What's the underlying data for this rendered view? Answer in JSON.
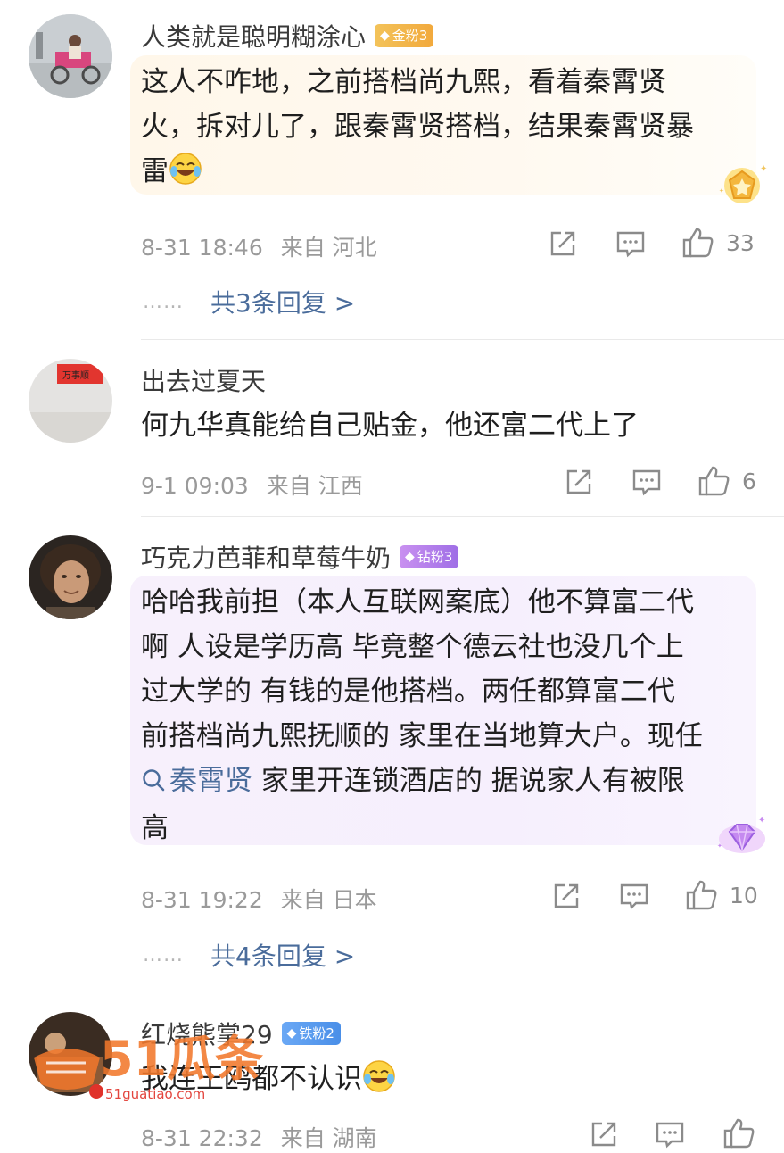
{
  "comments": [
    {
      "username": "人类就是聪明糊涂心",
      "badge": "金粉3",
      "lines": [
        "这人不咋地，之前搭档尚九熙，看着秦霄贤",
        "火，拆对儿了，跟秦霄贤搭档，结果秦霄贤暴",
        "雷"
      ],
      "time": "8-31 18:46",
      "from": "来自",
      "location": "河北",
      "likes": "33",
      "replies": "共3条回复 >"
    },
    {
      "username": "出去过夏天",
      "lines": [
        "何九华真能给自己贴金，他还富二代上了"
      ],
      "time": "9-1 09:03",
      "from": "来自",
      "location": "江西",
      "likes": "6"
    },
    {
      "username": "巧克力芭菲和草莓牛奶",
      "badge": "钻粉3",
      "lines": [
        "哈哈我前担（本人互联网案底）他不算富二代",
        "啊 人设是学历高 毕竟整个德云社也没几个上",
        "过大学的 有钱的是他搭档。两任都算富二代",
        "前搭档尚九熙抚顺的 家里在当地算大户。现任"
      ],
      "search_link": "秦霄贤",
      "line5_rest": " 家里开连锁酒店的 据说家人有被限",
      "line6": "高",
      "time": "8-31 19:22",
      "from": "来自",
      "location": "日本",
      "likes": "10",
      "replies": "共4条回复 >"
    },
    {
      "username": "红烧熊掌29",
      "badge": "铁粉2",
      "lines": [
        "我连王鸥都不认识"
      ],
      "time": "8-31 22:32",
      "from": "来自",
      "location": "湖南"
    }
  ],
  "reply_dots": "……",
  "watermark": {
    "big": "51瓜条",
    "url": "51guatiao.com"
  },
  "colors": {
    "link": "#4a6c9b",
    "meta": "#9a9a9a",
    "gold_badge": "#f2b24a",
    "diamond_badge": "#b07fe9",
    "iron_badge": "#5898ee"
  }
}
